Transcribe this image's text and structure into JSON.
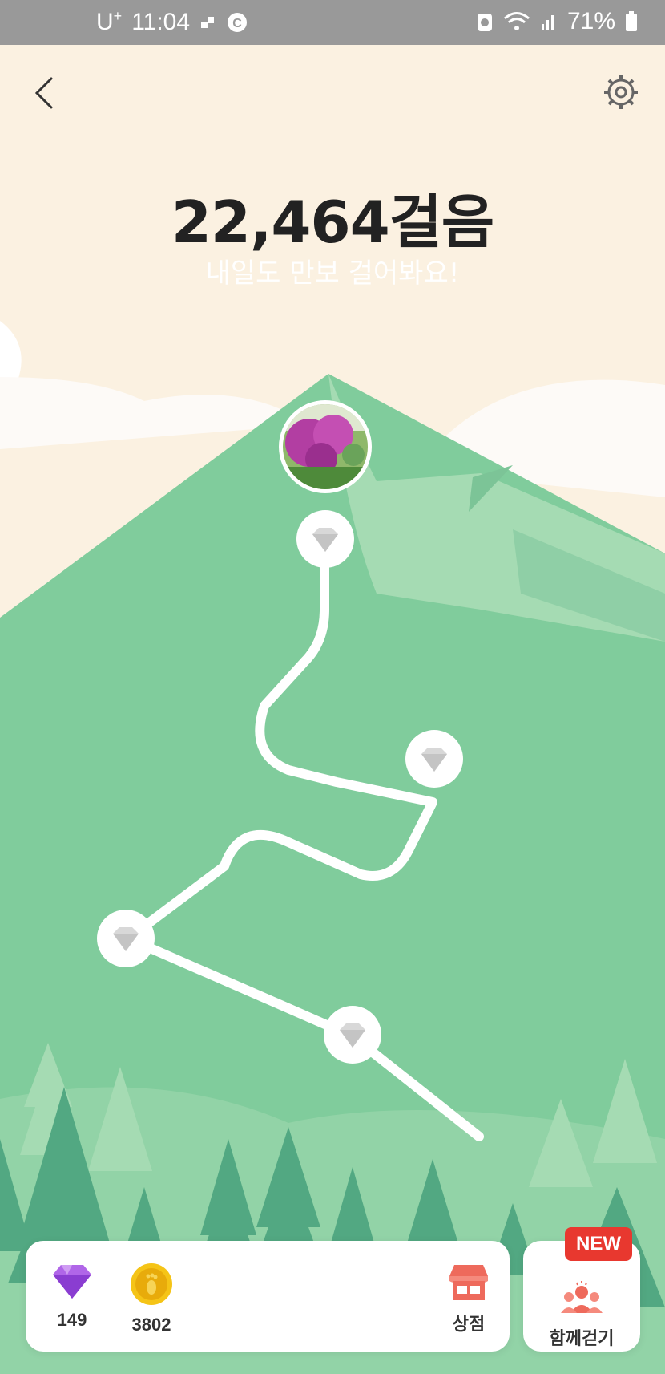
{
  "status_bar": {
    "carrier": "U",
    "carrier_sup": "+",
    "time": "11:04",
    "battery": "71%"
  },
  "header": {
    "back_icon": "chevron-left-icon",
    "settings_icon": "gear-icon"
  },
  "main": {
    "steps": "22,464걸음",
    "subtitle": "내일도 만보 걸어봐요!"
  },
  "path": {
    "checkpoints": [
      "diamond",
      "diamond",
      "diamond",
      "diamond"
    ],
    "summit_image": "azalea-photo"
  },
  "bottom": {
    "gems": "149",
    "coins": "3802",
    "shop_label": "상점",
    "walk_together_label": "함께걷기",
    "new_badge": "NEW"
  },
  "colors": {
    "mountain": "#80cc9c",
    "sky": "#fbf1e1",
    "tree_dark": "#52a882",
    "accent_red": "#e8382f"
  }
}
